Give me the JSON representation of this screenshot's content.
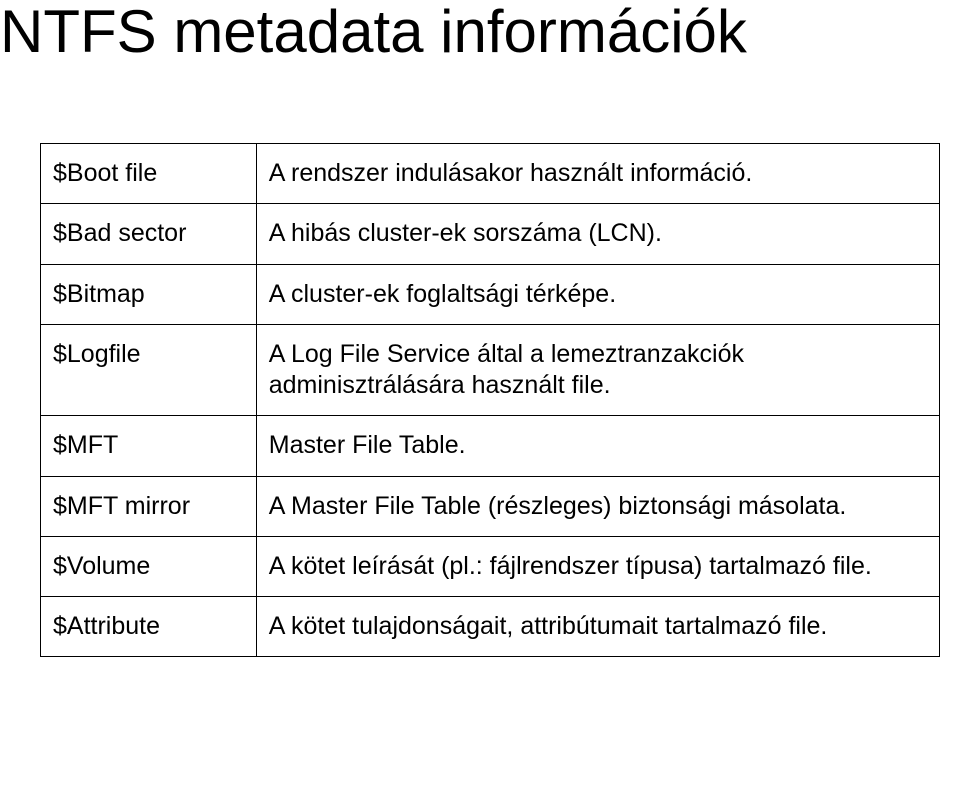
{
  "title": "NTFS metadata információk",
  "rows": [
    {
      "name": "$Boot file",
      "desc": "A rendszer indulásakor használt információ."
    },
    {
      "name": "$Bad sector",
      "desc": "A hibás cluster-ek sorszáma (LCN)."
    },
    {
      "name": "$Bitmap",
      "desc": "A cluster-ek foglaltsági térképe."
    },
    {
      "name": "$Logfile",
      "desc": "A Log File Service által a lemeztranzakciók adminisztrálására használt file."
    },
    {
      "name": "$MFT",
      "desc": "Master File Table."
    },
    {
      "name": "$MFT mirror",
      "desc": "A Master File Table (részleges) biztonsági másolata."
    },
    {
      "name": "$Volume",
      "desc": "A kötet leírását (pl.: fájlrendszer típusa) tartalmazó file."
    },
    {
      "name": "$Attribute",
      "desc": "A kötet tulajdonságait, attribútumait tartalmazó file."
    }
  ]
}
